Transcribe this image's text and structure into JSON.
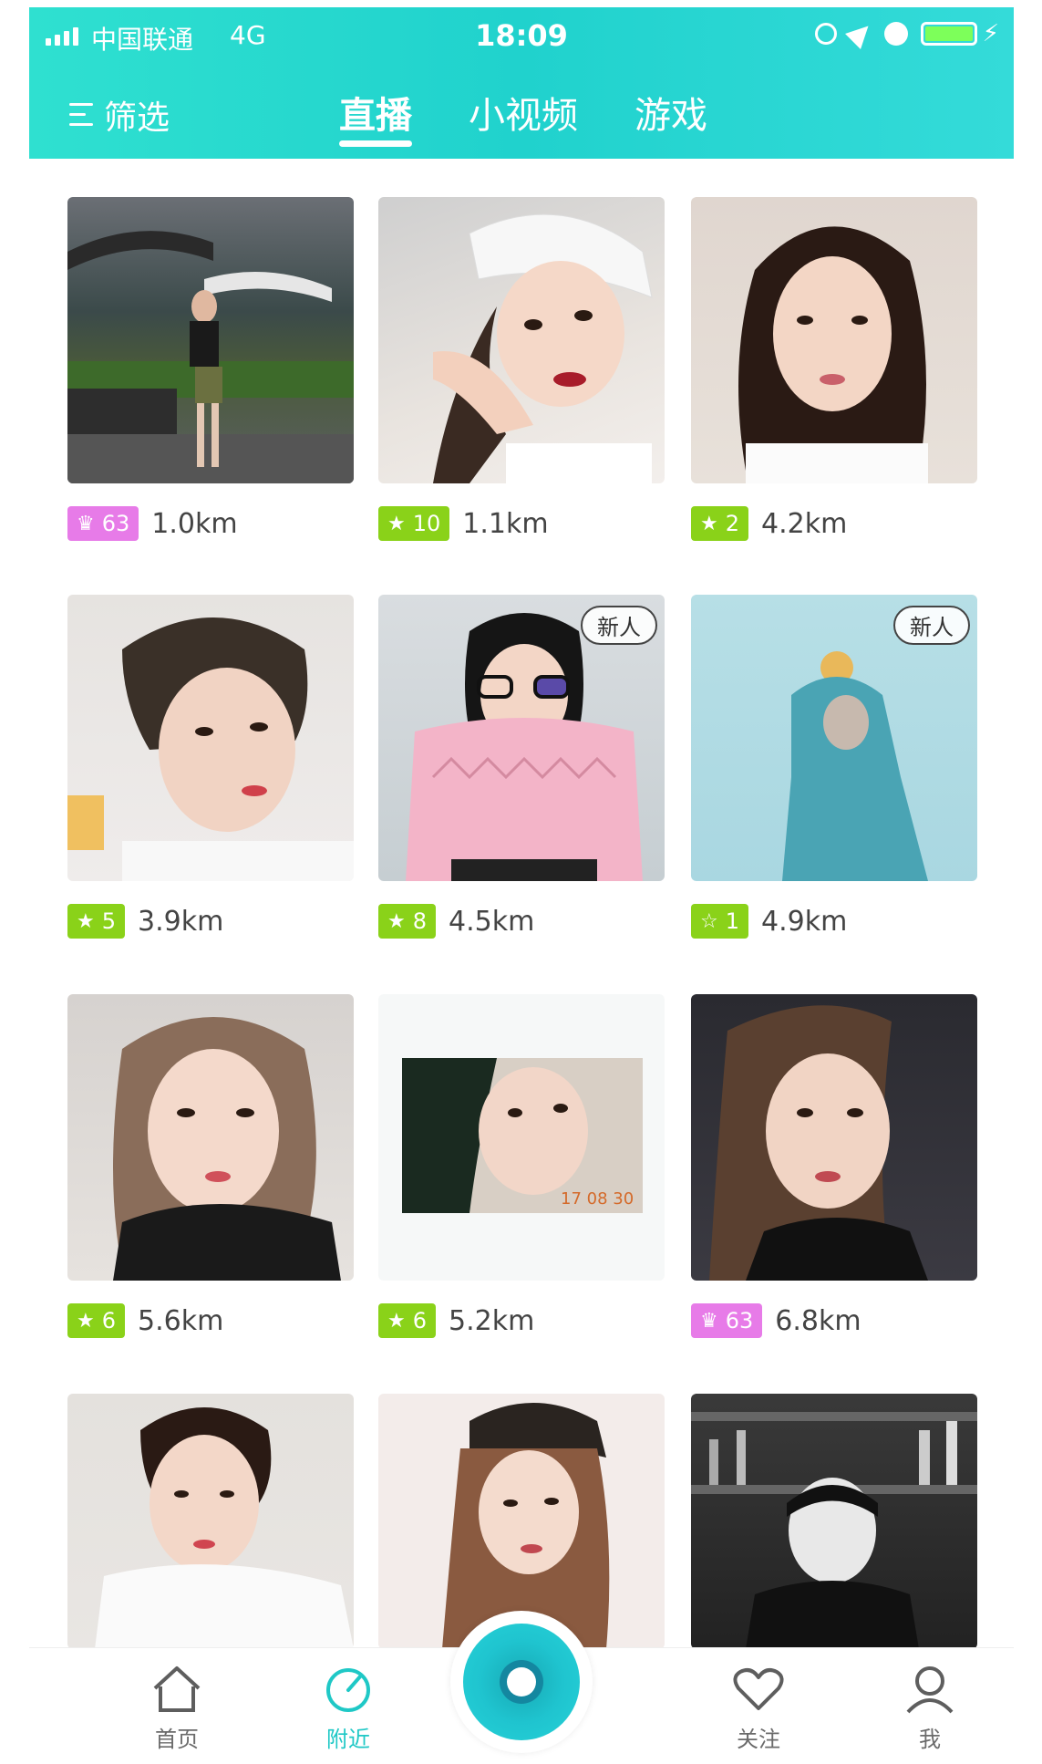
{
  "status_bar": {
    "carrier": "中国联通",
    "network": "4G",
    "time": "18:09"
  },
  "nav": {
    "filter_label": "筛选",
    "tabs": [
      {
        "label": "直播",
        "active": true
      },
      {
        "label": "小视频",
        "active": false
      },
      {
        "label": "游戏",
        "active": false
      }
    ]
  },
  "grid": {
    "items": [
      {
        "badge_type": "crown",
        "badge_value": "63",
        "distance": "1.0km",
        "new": false
      },
      {
        "badge_type": "star",
        "badge_value": "10",
        "distance": "1.1km",
        "new": false
      },
      {
        "badge_type": "star",
        "badge_value": "2",
        "distance": "4.2km",
        "new": false
      },
      {
        "badge_type": "star",
        "badge_value": "5",
        "distance": "3.9km",
        "new": false
      },
      {
        "badge_type": "star",
        "badge_value": "8",
        "distance": "4.5km",
        "new": true
      },
      {
        "badge_type": "star-outline",
        "badge_value": "1",
        "distance": "4.9km",
        "new": true
      },
      {
        "badge_type": "star",
        "badge_value": "6",
        "distance": "5.6km",
        "new": false
      },
      {
        "badge_type": "star",
        "badge_value": "6",
        "distance": "5.2km",
        "new": false
      },
      {
        "badge_type": "crown",
        "badge_value": "63",
        "distance": "6.8km",
        "new": false
      }
    ],
    "new_label": "新人"
  },
  "tabbar": {
    "home": "首页",
    "nearby": "附近",
    "follow": "关注",
    "me": "我"
  },
  "colors": {
    "header_gradient_start": "#2fe0d0",
    "header_gradient_end": "#34dbd9",
    "star_badge": "#8ad219",
    "crown_badge": "#e77be8",
    "active_tab": "#1fc8c6"
  }
}
